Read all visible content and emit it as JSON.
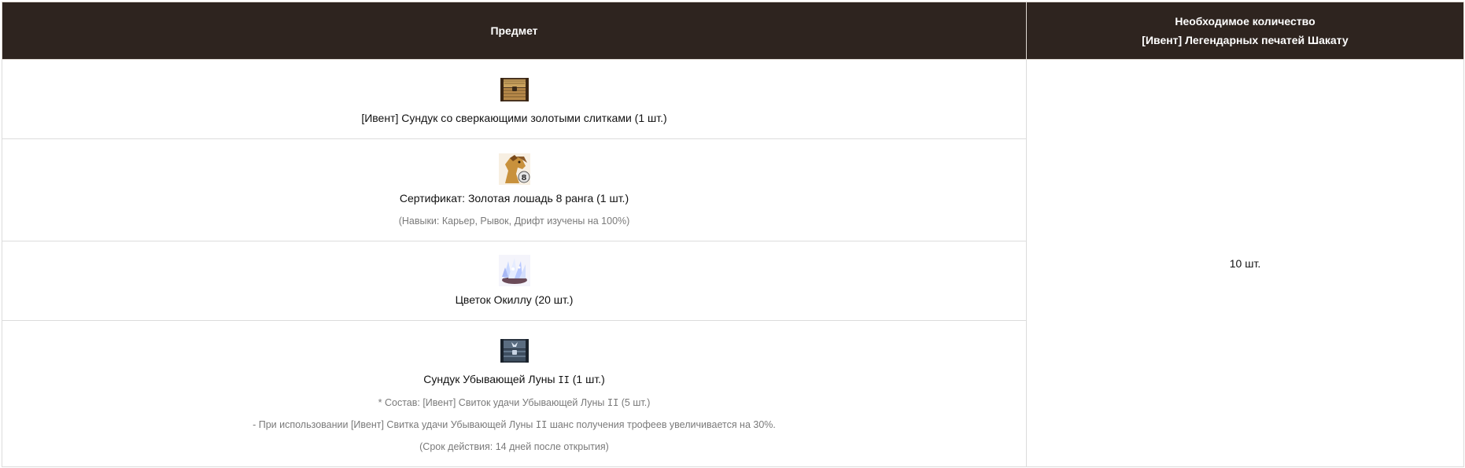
{
  "table": {
    "headers": {
      "item": "Предмет",
      "required_line1": "Необходимое количество",
      "required_line2": "[Ивент] Легендарных печатей Шакату"
    },
    "quantity": "10 шт.",
    "rows": [
      {
        "icon": "treasure-chest-icon",
        "name": "[Ивент] Сундук со сверкающими золотыми слитками (1 шт.)"
      },
      {
        "icon": "golden-horse-icon",
        "name": "Сертификат: Золотая лошадь 8 ранга (1 шт.)",
        "note": "(Навыки: Карьер, Рывок, Дрифт изучены на 100%)"
      },
      {
        "icon": "crystal-flower-icon",
        "name": "Цветок Окиллу (20 шт.)"
      },
      {
        "icon": "dark-chest-icon",
        "name_prefix": "Сундук Убывающей Луны ",
        "name_numeral": "II",
        "name_suffix": " (1 шт.)",
        "notes": [
          {
            "prefix": "* Состав: [Ивент] Свиток удачи Убывающей Луны ",
            "numeral": "II",
            "suffix": " (5 шт.)"
          },
          {
            "prefix": "- При использовании [Ивент] Свитка удачи Убывающей Луны ",
            "numeral": "II",
            "suffix": " шанс получения трофеев увеличивается на 30%."
          },
          {
            "text": "(Срок действия: 14 дней после открытия)"
          }
        ]
      }
    ]
  },
  "colors": {
    "header_bg": "#2e241f",
    "header_text": "#ffffff",
    "border": "#dcdcdc",
    "note_text": "#7a7a7a"
  }
}
